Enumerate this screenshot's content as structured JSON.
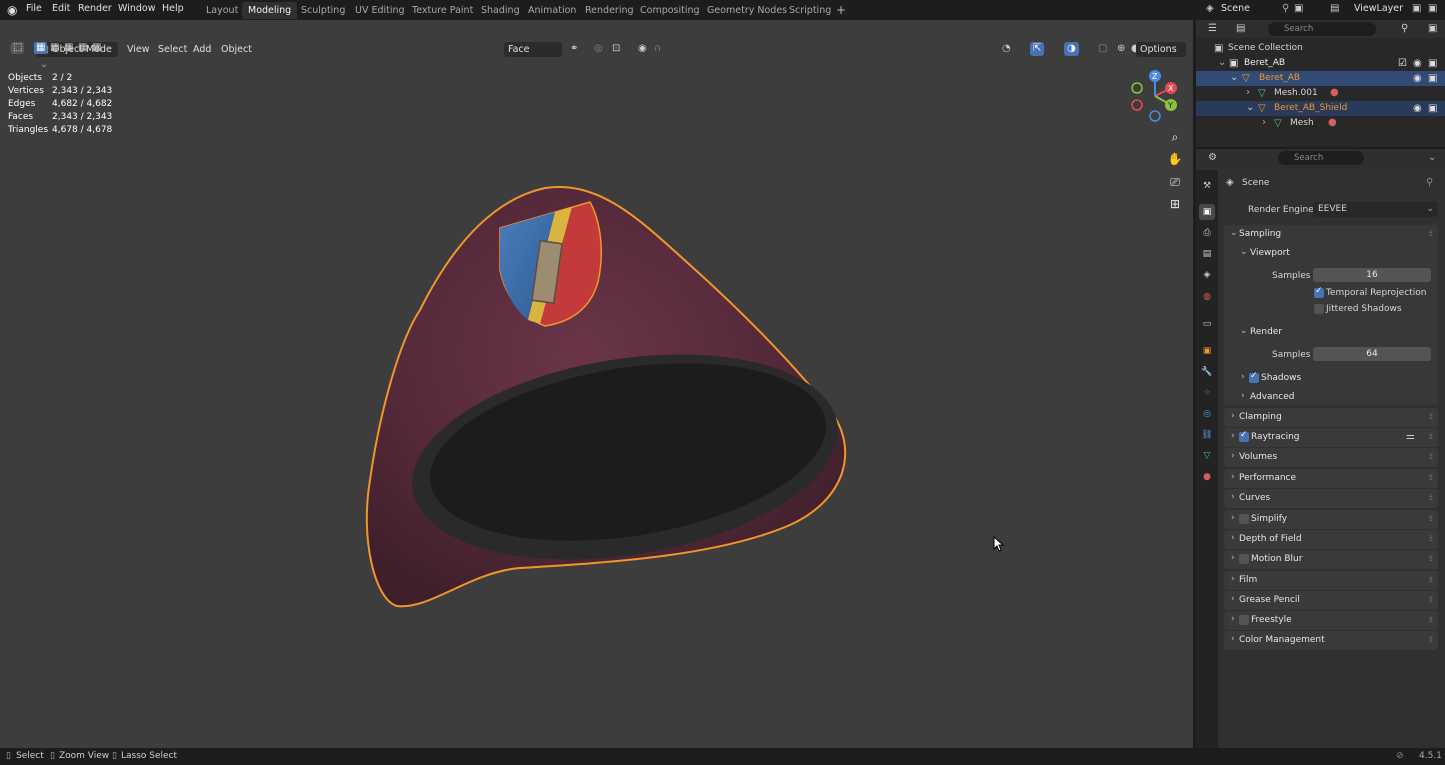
{
  "menus": [
    "File",
    "Edit",
    "Render",
    "Window",
    "Help"
  ],
  "workspaces": [
    "Layout",
    "Modeling",
    "Sculpting",
    "UV Editing",
    "Texture Paint",
    "Shading",
    "Animation",
    "Rendering",
    "Compositing",
    "Geometry Nodes",
    "Scripting"
  ],
  "active_workspace": "Modeling",
  "scene": "Scene",
  "view_layer": "ViewLayer",
  "viewport_header": {
    "mode": "Object Mode",
    "view": "View",
    "select": "Select",
    "add": "Add",
    "object": "Object",
    "orientation": "Face",
    "options": "Options"
  },
  "stats": [
    {
      "label": "Objects",
      "value": "2 / 2"
    },
    {
      "label": "Vertices",
      "value": "2,343 / 2,343"
    },
    {
      "label": "Edges",
      "value": "4,682 / 4,682"
    },
    {
      "label": "Faces",
      "value": "2,343 / 2,343"
    },
    {
      "label": "Triangles",
      "value": "4,678 / 4,678"
    }
  ],
  "outliner": {
    "search_placeholder": "Search",
    "rows": [
      {
        "label": "Scene Collection"
      },
      {
        "label": "Beret_AB"
      },
      {
        "label": "Beret_AB"
      },
      {
        "label": "Mesh.001"
      },
      {
        "label": "Beret_AB_Shield"
      },
      {
        "label": "Mesh"
      }
    ]
  },
  "properties": {
    "search_placeholder": "Search",
    "context": "Scene",
    "render_engine_label": "Render Engine",
    "render_engine": "EEVEE",
    "sampling": "Sampling",
    "viewport": "Viewport",
    "viewport_samples_label": "Samples",
    "viewport_samples": "16",
    "temporal_reprojection": "Temporal Reprojection",
    "jittered_shadows": "Jittered Shadows",
    "render": "Render",
    "render_samples_label": "Samples",
    "render_samples": "64",
    "shadows": "Shadows",
    "advanced": "Advanced",
    "panels": [
      "Clamping",
      "Raytracing",
      "Volumes",
      "Performance",
      "Curves",
      "Simplify",
      "Depth of Field",
      "Motion Blur",
      "Film",
      "Grease Pencil",
      "Freestyle",
      "Color Management"
    ]
  },
  "statusbar": {
    "select": "Select",
    "zoom_view": "Zoom View",
    "lasso_select": "Lasso Select",
    "version": "4.5.1"
  },
  "colors": {
    "selection_outline": "#f0962a",
    "beret": "#5a2f3d",
    "accent": "#4772b3"
  }
}
